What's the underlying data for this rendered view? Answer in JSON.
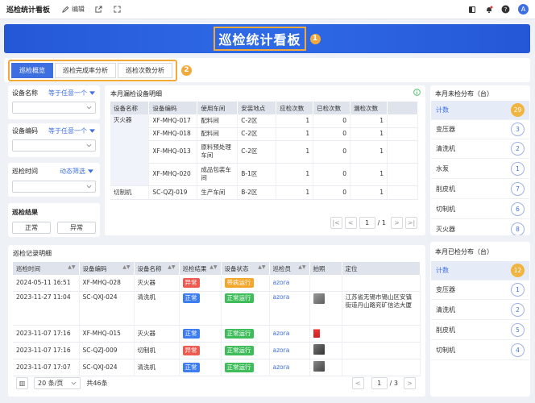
{
  "topbar": {
    "title": "巡检统计看板",
    "edit_label": "编辑",
    "avatar_initial": "A"
  },
  "banner": {
    "title": "巡检统计看板",
    "badge": "1"
  },
  "tabs": {
    "items": [
      "巡检概览",
      "巡检完成率分析",
      "巡检次数分析"
    ],
    "active": 0,
    "badge": "2"
  },
  "filters": {
    "device_name": {
      "label": "设备名称",
      "op": "等于任意一个"
    },
    "device_code": {
      "label": "设备编码",
      "op": "等于任意一个"
    },
    "inspect_time": {
      "label": "巡检时间",
      "op": "动态筛选"
    },
    "result": {
      "label": "巡检结果",
      "normal": "正常",
      "abnormal": "异常"
    }
  },
  "missed": {
    "title": "本月漏检设备明细",
    "columns": [
      "设备名称",
      "设备编码",
      "使用车间",
      "安装地点",
      "应检次数",
      "已检次数",
      "漏检次数"
    ],
    "rows": [
      {
        "name": "灭火器",
        "code": "XF-MHQ-017",
        "workshop": "配料间",
        "location": "C-2区",
        "due": "1",
        "done": "0",
        "missed": "1"
      },
      {
        "name": "",
        "code": "XF-MHQ-018",
        "workshop": "配料间",
        "location": "C-2区",
        "due": "1",
        "done": "0",
        "missed": "1"
      },
      {
        "name": "",
        "code": "XF-MHQ-013",
        "workshop": "原料预处理车间",
        "location": "C-2区",
        "due": "1",
        "done": "0",
        "missed": "1"
      },
      {
        "name": "",
        "code": "XF-MHQ-020",
        "workshop": "成品包装车间",
        "location": "B-1区",
        "due": "1",
        "done": "0",
        "missed": "1"
      },
      {
        "name": "切制机",
        "code": "SC-QZJ-019",
        "workshop": "生产车间",
        "location": "B-2区",
        "due": "1",
        "done": "0",
        "missed": "1"
      }
    ],
    "pager": {
      "page": "1",
      "total": "/ 1"
    }
  },
  "records": {
    "title": "巡检记录明细",
    "columns": [
      "巡检时间",
      "设备编码",
      "设备名称",
      "巡检结果",
      "设备状态",
      "巡检员",
      "拍照",
      "定位"
    ],
    "rows": [
      {
        "time": "2024-05-11 16:51",
        "code": "XF-MHQ-028",
        "name": "灭火器",
        "result": "异常",
        "status": "带病运行",
        "inspector": "azora",
        "location": ""
      },
      {
        "time": "2023-11-27 11:04",
        "code": "SC-QXJ-024",
        "name": "清洗机",
        "result": "正常",
        "status": "正常运行",
        "inspector": "azora",
        "location": "江苏省无锡市锡山区安镇街道丹山路兖矿信达大厦"
      },
      {
        "time": "2023-11-07 17:16",
        "code": "XF-MHQ-015",
        "name": "灭火器",
        "result": "正常",
        "status": "正常运行",
        "inspector": "azora",
        "location": ""
      },
      {
        "time": "2023-11-07 17:16",
        "code": "SC-QZJ-009",
        "name": "切制机",
        "result": "异常",
        "status": "正常运行",
        "inspector": "azora",
        "location": ""
      },
      {
        "time": "2023-11-07 17:07",
        "code": "SC-QXJ-024",
        "name": "清洗机",
        "result": "正常",
        "status": "正常运行",
        "inspector": "azora",
        "location": ""
      }
    ],
    "page_size": "20 条/页",
    "total": "共46条",
    "pager": {
      "page": "1",
      "total": "/ 3"
    }
  },
  "unchecked": {
    "title": "本月未检分布（台）",
    "items": [
      {
        "label": "计数",
        "value": "29"
      },
      {
        "label": "变压器",
        "value": "3"
      },
      {
        "label": "清洗机",
        "value": "2"
      },
      {
        "label": "水泵",
        "value": "1"
      },
      {
        "label": "削皮机",
        "value": "7"
      },
      {
        "label": "切制机",
        "value": "6"
      },
      {
        "label": "灭火器",
        "value": "8"
      }
    ]
  },
  "checked": {
    "title": "本月已检分布（台）",
    "items": [
      {
        "label": "计数",
        "value": "12"
      },
      {
        "label": "变压器",
        "value": "1"
      },
      {
        "label": "清洗机",
        "value": "2"
      },
      {
        "label": "削皮机",
        "value": "5"
      },
      {
        "label": "切制机",
        "value": "4"
      }
    ]
  }
}
